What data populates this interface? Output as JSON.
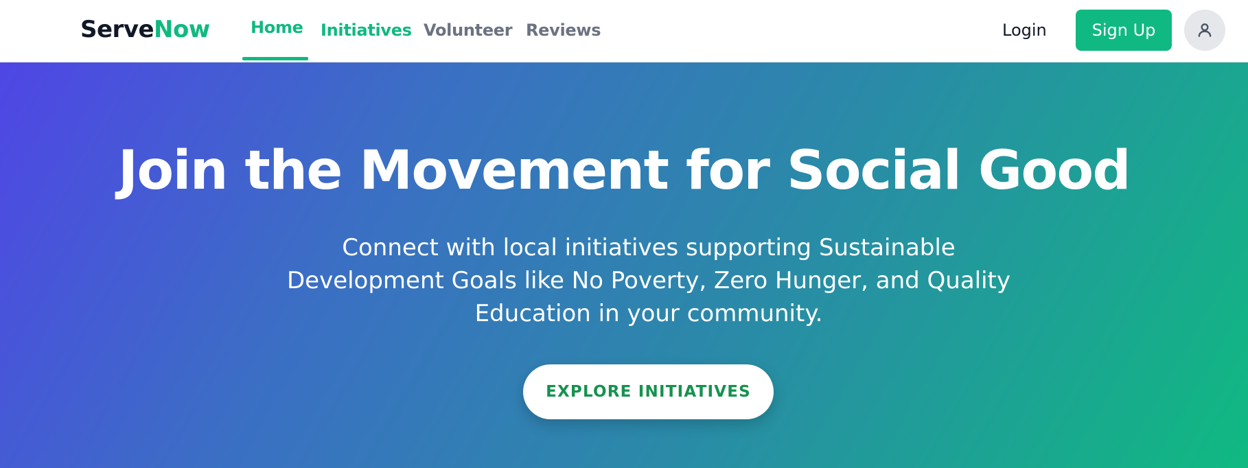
{
  "brand": {
    "name_part1": "Serve",
    "name_part2": "Now",
    "color_dark": "#111827",
    "color_accent": "#10b981"
  },
  "nav": {
    "items": [
      {
        "label": "Home",
        "active": true
      },
      {
        "label": "Initiatives",
        "active": false
      },
      {
        "label": "Volunteer",
        "active": false
      },
      {
        "label": "Reviews",
        "active": false
      }
    ],
    "login_label": "Login",
    "signup_label": "Sign Up",
    "avatar_icon": "user-icon"
  },
  "hero": {
    "title": "Join the Movement for Social Good",
    "subtitle": "Connect with local initiatives supporting Sustainable Development Goals like No Poverty, Zero Hunger, and Quality Education in your community.",
    "cta_label": "EXPLORE INITIATIVES",
    "gradient_start": "#4f46e5",
    "gradient_end": "#10b981"
  }
}
